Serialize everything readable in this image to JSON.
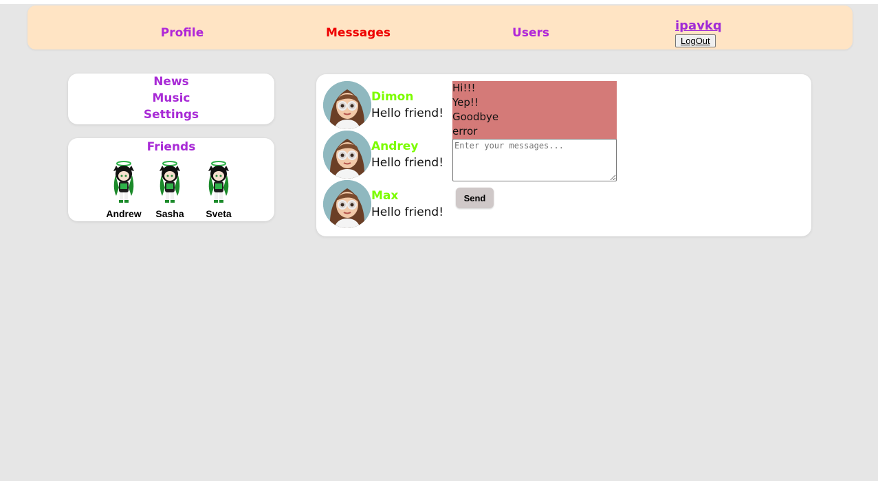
{
  "header": {
    "nav": [
      {
        "label": "Profile",
        "active": false
      },
      {
        "label": "Messages",
        "active": true
      },
      {
        "label": "Users",
        "active": false
      }
    ],
    "username": "ipavkq",
    "logout_label": "LogOut"
  },
  "sidebar": {
    "links": [
      "News",
      "Music",
      "Settings"
    ],
    "friends_title": "Friends",
    "friends": [
      "Andrew",
      "Sasha",
      "Sveta"
    ]
  },
  "dialogs": [
    {
      "name": "Dimon",
      "text": "Hello friend!"
    },
    {
      "name": "Andrey",
      "text": "Hello friend!"
    },
    {
      "name": "Max",
      "text": "Hello friend!"
    }
  ],
  "messages": [
    "Hi!!!",
    "Yep!!",
    "Goodbye",
    "error"
  ],
  "composer": {
    "placeholder": "Enter your messages...",
    "value": "",
    "send_label": "Send"
  },
  "colors": {
    "active_nav": "#ee0000",
    "nav": "#b026d8",
    "dialog_name": "#7cfc00",
    "header_bg": "#ffe4c4",
    "messages_bg": "#d47a78"
  }
}
